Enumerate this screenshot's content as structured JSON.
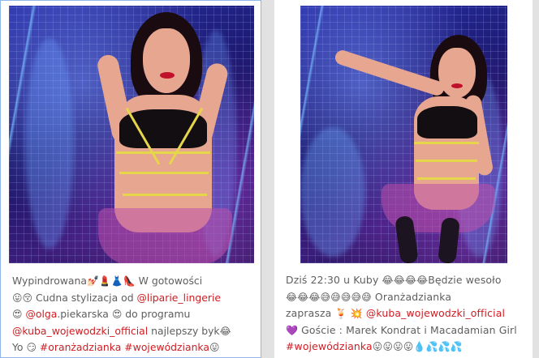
{
  "posts": [
    {
      "image_alt": "Woman in a black bra with yellow strap harness and pink tulle skirt in a blue-lit wire tunnel",
      "caption_lines": [
        [
          {
            "t": "text",
            "v": "Wypindrowana"
          },
          {
            "t": "emoji",
            "v": "💅🏻💄👗👠"
          },
          {
            "t": "text",
            "v": " W gotowości"
          }
        ],
        [
          {
            "t": "emoji",
            "v": "😛😚"
          },
          {
            "t": "text",
            "v": " Cudna stylizacja od "
          },
          {
            "t": "link",
            "v": "@liparie_lingerie"
          }
        ],
        [
          {
            "t": "emoji",
            "v": "😍"
          },
          {
            "t": "text",
            "v": " "
          },
          {
            "t": "link",
            "v": "@olga"
          },
          {
            "t": "text",
            "v": ".piekarska "
          },
          {
            "t": "emoji",
            "v": "😍"
          },
          {
            "t": "text",
            "v": " do programu"
          }
        ],
        [
          {
            "t": "link",
            "v": "@kuba_wojewodzki_official"
          },
          {
            "t": "text",
            "v": " najlepszy byk"
          },
          {
            "t": "emoji",
            "v": "😂"
          }
        ],
        [
          {
            "t": "text",
            "v": "Yo "
          },
          {
            "t": "emoji",
            "v": "😏"
          },
          {
            "t": "text",
            "v": " "
          },
          {
            "t": "link",
            "v": "#oranżadzianka"
          },
          {
            "t": "text",
            "v": " "
          },
          {
            "t": "link",
            "v": "#wojewódzianka"
          },
          {
            "t": "emoji",
            "v": "😛"
          }
        ]
      ]
    },
    {
      "image_alt": "Woman in a black bra with yellow strap harness and pink tulle skirt posing in a blue neon wire tunnel",
      "caption_lines": [
        [
          {
            "t": "text",
            "v": "Dziś 22:30 u Kuby "
          },
          {
            "t": "emoji",
            "v": "😂😂😂😂"
          },
          {
            "t": "text",
            "v": "Będzie wesoło"
          }
        ],
        [
          {
            "t": "emoji",
            "v": "😂😂😂😅😅😅😅😅"
          },
          {
            "t": "text",
            "v": " Oranżadzianka"
          }
        ],
        [
          {
            "t": "text",
            "v": "zaprasza "
          },
          {
            "t": "emoji",
            "v": "🍹"
          },
          {
            "t": "text",
            "v": " "
          },
          {
            "t": "emoji",
            "v": "💥"
          },
          {
            "t": "text",
            "v": " "
          },
          {
            "t": "link",
            "v": "@kuba_wojewodzki_official"
          }
        ],
        [
          {
            "t": "emoji",
            "v": "💜"
          },
          {
            "t": "text",
            "v": " Goście : Marek Kondrat i Macadamian Girl"
          }
        ],
        [
          {
            "t": "link",
            "v": "#wojewódzianka"
          },
          {
            "t": "emoji",
            "v": "😛😛😛😛💧💦💦💦"
          }
        ]
      ]
    }
  ]
}
